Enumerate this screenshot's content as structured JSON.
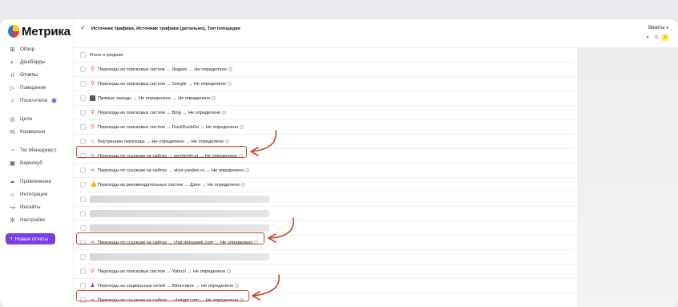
{
  "app": {
    "logo_text": "Метрика"
  },
  "sidebar": {
    "items": [
      {
        "label": "Обзор",
        "icon": "grid-icon"
      },
      {
        "label": "Дашборды",
        "icon": "dashboard-icon"
      },
      {
        "label": "Отчеты",
        "icon": "reports-icon",
        "active": true
      },
      {
        "label": "Поведение",
        "icon": "play-icon"
      },
      {
        "label": "Посетители",
        "icon": "visitors-icon"
      },
      {
        "label": "Цели",
        "icon": "target-icon"
      },
      {
        "label": "Конверсии",
        "icon": "percent-icon"
      },
      {
        "label": "Тег Менеджер",
        "icon": "tag-icon",
        "sup": "β"
      },
      {
        "label": "Вариокуб",
        "icon": "cube-icon"
      },
      {
        "label": "Привлечение",
        "icon": "megaphone-icon"
      },
      {
        "label": "Интеграции",
        "icon": "integrations-icon"
      },
      {
        "label": "Инсайты",
        "icon": "insights-icon"
      },
      {
        "label": "Настройки",
        "icon": "gear-icon"
      }
    ],
    "new_reports_button": "Новые отчеты"
  },
  "header": {
    "title": "Источник трафика, Источник трафика (детально), Тип площадки"
  },
  "metric_panel": {
    "metric": "Визиты"
  },
  "table": {
    "total_label": "Итого и средние",
    "rows": [
      {
        "text": "Переходы из поисковых систем → Яндекс → Не определено",
        "icon": "search-icon"
      },
      {
        "text": "Переходы из поисковых систем → Google → Не определено",
        "icon": "search-icon"
      },
      {
        "text": "Прямые заходы → Не определено → Не определено",
        "icon": "direct-icon"
      },
      {
        "text": "Переходы из поисковых систем → Bing → Не определено",
        "icon": "search-icon"
      },
      {
        "text": "Переходы из поисковых систем → DuckDuckGo → Не определено",
        "icon": "search-icon"
      },
      {
        "text": "Внутренние переходы → Не определено → Не определено",
        "icon": "internal-icon"
      },
      {
        "text": "Переходы по ссылкам на сайтах → perplexity.ai → Не определено",
        "icon": "link-icon",
        "highlight": true
      },
      {
        "text": "Переходы по ссылкам на сайтах → alice.yandex.ru → Не определено",
        "icon": "link-icon"
      },
      {
        "text": "Переходы из рекомендательных систем → Дзен → Не определено",
        "icon": "recommend-icon"
      },
      {
        "blurred": true
      },
      {
        "blurred": true
      },
      {
        "blurred": true
      },
      {
        "text": "Переходы по ссылкам на сайтах → chat.deepseek.com → Не определено",
        "icon": "link-icon",
        "highlight": true
      },
      {
        "blurred": true
      },
      {
        "text": "Переходы из поисковых систем → Yahoo! → Не определено",
        "icon": "search-icon"
      },
      {
        "text": "Переходы из социальных сетей → ВКонтакте → Не определено",
        "icon": "social-icon"
      },
      {
        "text": "Переходы по ссылкам на сайтах → chatgpt.com → Не определено",
        "icon": "link-icon",
        "highlight": true
      }
    ]
  },
  "colors": {
    "accent": "#7b3fe4",
    "highlight": "#c5462c",
    "search": "#f24b2c",
    "link": "#3b7be8"
  }
}
